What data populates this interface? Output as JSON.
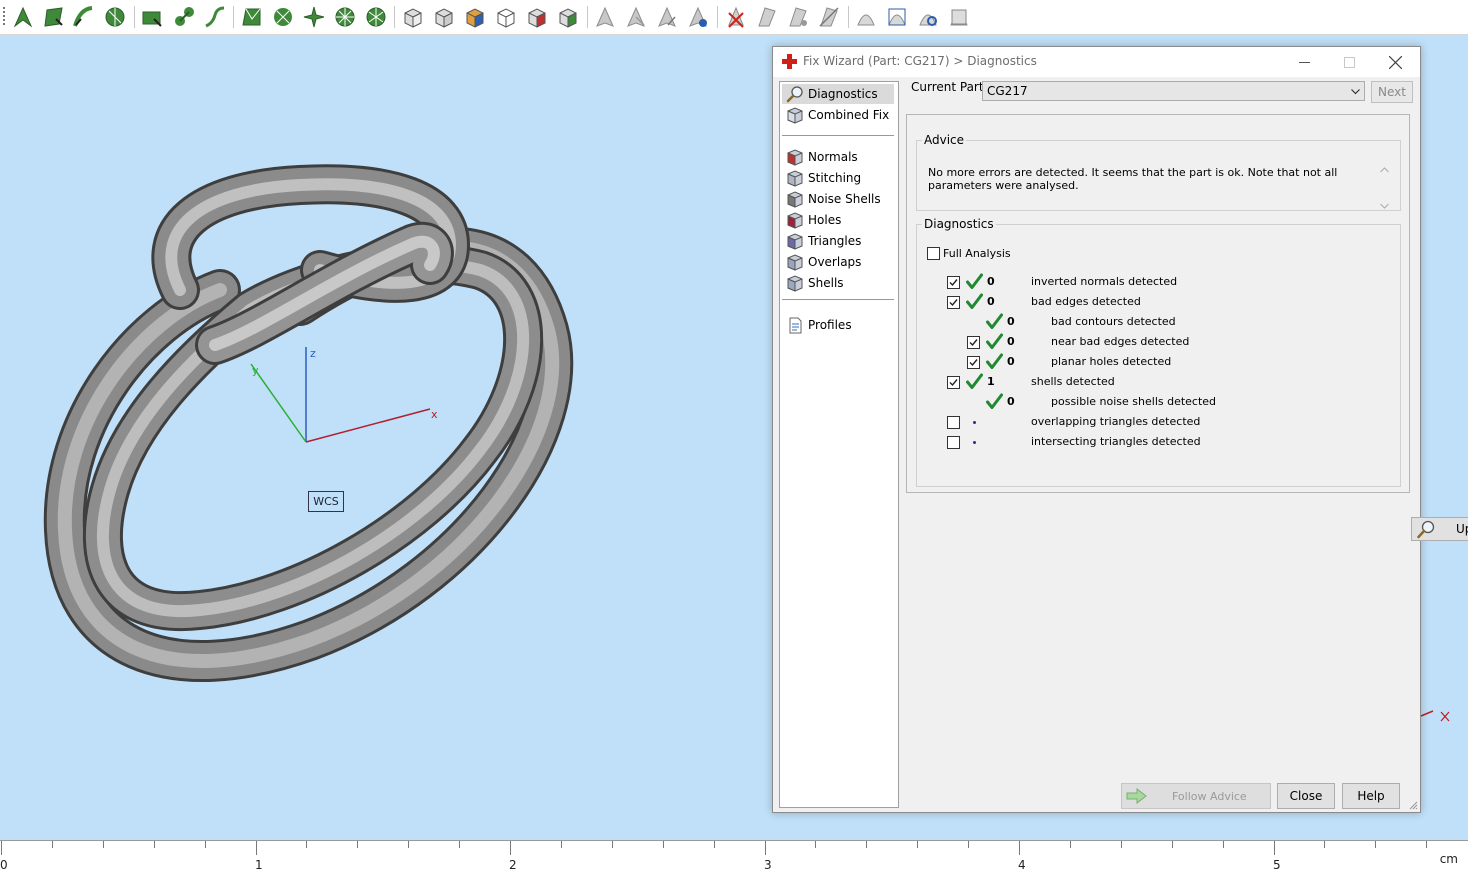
{
  "toolbar": {
    "icons": [
      "arrow-tool-icon",
      "triangle-select-icon",
      "curve-select-icon",
      "surface-select-icon",
      "plane-cut-icon",
      "knot-tool-icon",
      "branch-tool-icon",
      "mesh-edit-icon",
      "gear-tool-icon",
      "star-tool-icon",
      "wheel-tool-icon",
      "spoke-tool-icon",
      "cube-view-icon",
      "cube-front-icon",
      "cube-color-icon",
      "cube-wire-icon",
      "cube-red-icon",
      "cube-green-icon",
      "cone-icon",
      "cone-half-icon",
      "cone-arrow-icon",
      "cone-blue-icon",
      "delete-mark-icon",
      "prism-icon",
      "prism-dot-icon",
      "prism-slash-icon",
      "dome-icon",
      "dome-scan-icon",
      "dome-magnify-icon",
      "dome-flat-icon"
    ]
  },
  "viewport": {
    "background": "#bfe0f8",
    "axes": {
      "x_label": "x",
      "y_label": "y",
      "z_label": "z"
    },
    "wcs_label": "WCS"
  },
  "ruler": {
    "labels": [
      "0",
      "1",
      "2",
      "3",
      "4",
      "5"
    ],
    "unit": "cm"
  },
  "dialog": {
    "title": "Fix Wizard (Part: CG217) > Diagnostics",
    "nav": [
      {
        "label": "Diagnostics",
        "icon": "magnifier-icon",
        "selected": true
      },
      {
        "label": "Combined Fix",
        "icon": "combined-fix-icon"
      },
      {
        "label": "Normals",
        "icon": "normals-cube-icon"
      },
      {
        "label": "Stitching",
        "icon": "stitching-cube-icon"
      },
      {
        "label": "Noise Shells",
        "icon": "noise-shells-icon"
      },
      {
        "label": "Holes",
        "icon": "holes-cube-icon"
      },
      {
        "label": "Triangles",
        "icon": "triangles-cube-icon"
      },
      {
        "label": "Overlaps",
        "icon": "overlaps-cube-icon"
      },
      {
        "label": "Shells",
        "icon": "shells-cube-icon"
      },
      {
        "label": "Profiles",
        "icon": "profiles-doc-icon"
      }
    ],
    "current_part_label": "Current Part:",
    "current_part_value": "CG217",
    "next_label": "Next",
    "advice_legend": "Advice",
    "advice_text": "No more errors are detected. It seems that the part is ok. Note that not all parameters were analysed.",
    "diagnostics_legend": "Diagnostics",
    "full_analysis_label": "Full Analysis",
    "full_analysis_checked": false,
    "rows": [
      {
        "checkbox": true,
        "checked": true,
        "status": "ok",
        "count": "0",
        "label": "inverted normals detected",
        "indent": 0
      },
      {
        "checkbox": true,
        "checked": true,
        "status": "ok",
        "count": "0",
        "label": "bad edges detected",
        "indent": 0
      },
      {
        "checkbox": false,
        "checked": false,
        "status": "ok",
        "count": "0",
        "label": "bad contours detected",
        "indent": 1
      },
      {
        "checkbox": true,
        "checked": true,
        "status": "ok",
        "count": "0",
        "label": "near bad edges detected",
        "indent": 1
      },
      {
        "checkbox": true,
        "checked": true,
        "status": "ok",
        "count": "0",
        "label": "planar holes detected",
        "indent": 1
      },
      {
        "checkbox": true,
        "checked": true,
        "status": "ok",
        "count": "1",
        "label": "shells detected",
        "indent": 0
      },
      {
        "checkbox": false,
        "checked": false,
        "status": "ok",
        "count": "0",
        "label": "possible noise shells detected",
        "indent": 1
      },
      {
        "checkbox": true,
        "checked": false,
        "status": "pending",
        "count": "",
        "label": "overlapping triangles detected",
        "indent": 0
      },
      {
        "checkbox": true,
        "checked": false,
        "status": "pending",
        "count": "",
        "label": "intersecting triangles detected",
        "indent": 0
      }
    ],
    "update_label": "Update",
    "follow_advice_label": "Follow Advice",
    "close_label": "Close",
    "help_label": "Help",
    "colors": {
      "ok_tick": "#1f8a2f",
      "pending_dot": "#2030a0",
      "brand_red": "#d0201a"
    }
  }
}
